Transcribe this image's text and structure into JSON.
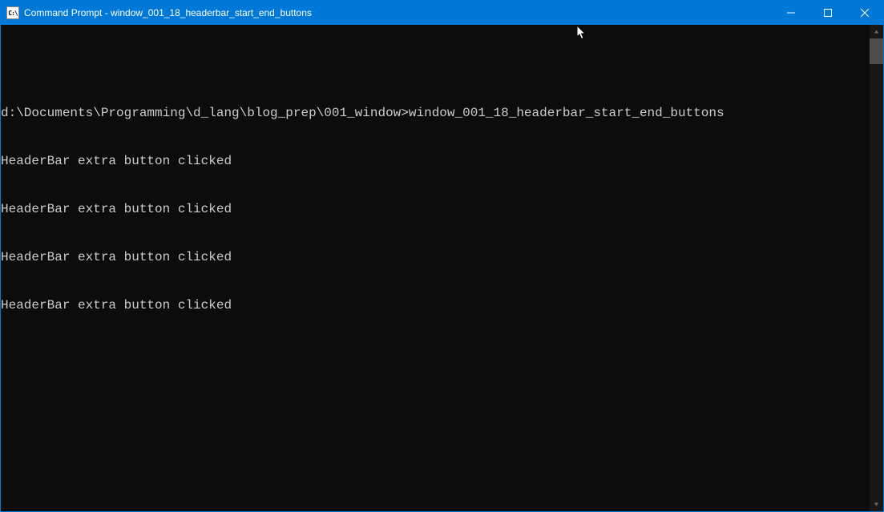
{
  "titlebar": {
    "icon_label": "C:\\",
    "title": "Command Prompt - window_001_18_headerbar_start_end_buttons"
  },
  "terminal": {
    "prompt": "d:\\Documents\\Programming\\d_lang\\blog_prep\\001_window>",
    "command": "window_001_18_headerbar_start_end_buttons",
    "output_lines": [
      "HeaderBar extra button clicked",
      "HeaderBar extra button clicked",
      "HeaderBar extra button clicked",
      "HeaderBar extra button clicked"
    ]
  },
  "colors": {
    "titlebar_bg": "#0078D7",
    "terminal_bg": "#0c0c0c",
    "terminal_fg": "#cccccc"
  }
}
